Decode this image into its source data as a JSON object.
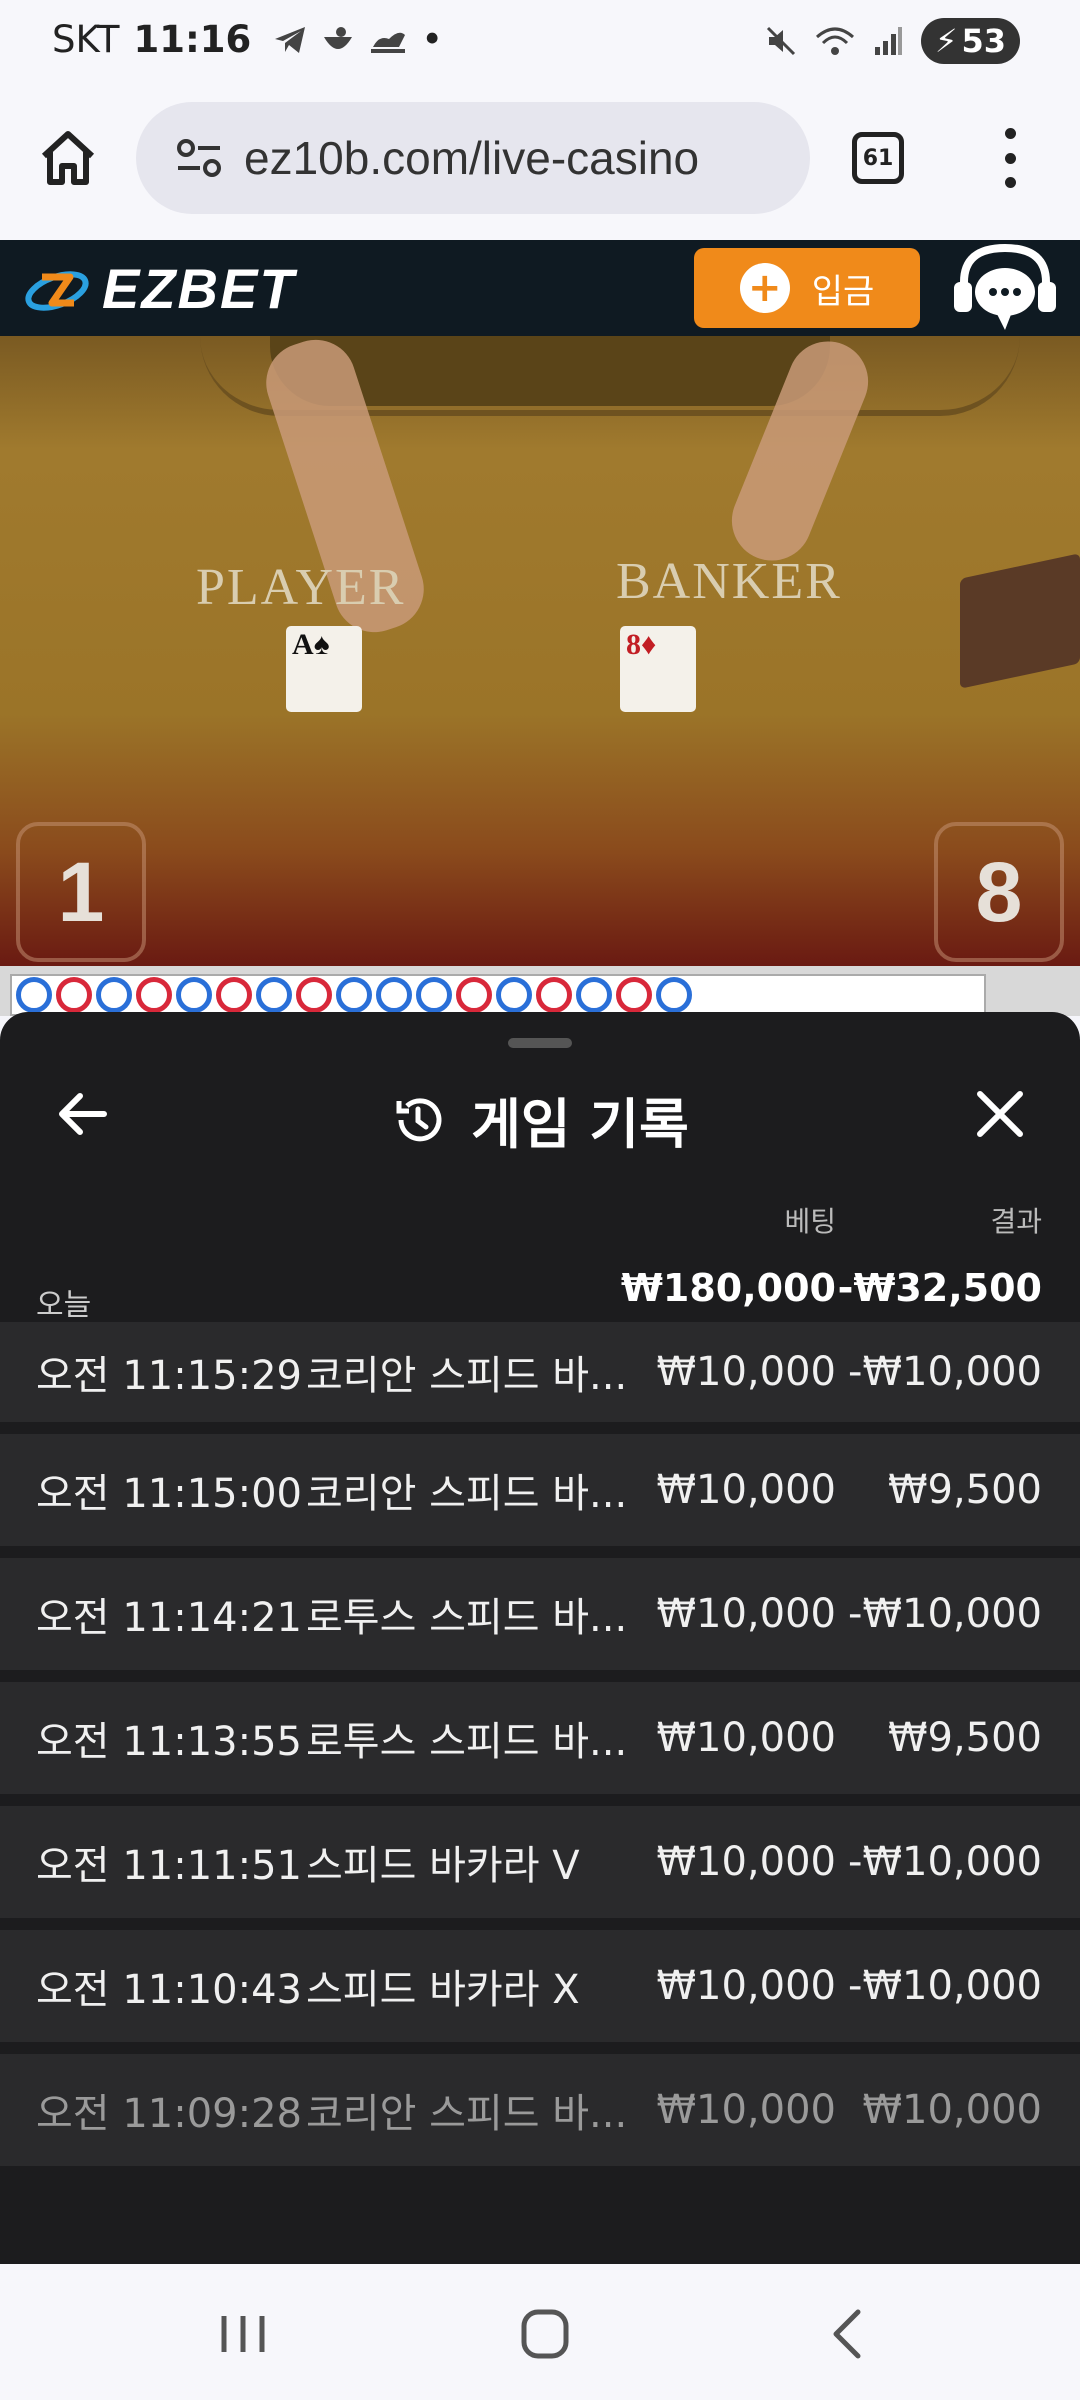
{
  "status_bar": {
    "carrier": "SKT",
    "time": "11:16",
    "dot": "•",
    "battery": "53",
    "icons": [
      "telegram-icon",
      "app-icon",
      "app-icon-2",
      "mute-icon",
      "wifi-icon",
      "signal-icon",
      "battery-icon"
    ]
  },
  "browser": {
    "url": "ez10b.com/live-casino",
    "tab_count": "61"
  },
  "site": {
    "logo_text": "EZBET",
    "deposit_label": "입금",
    "accent_color": "#f08a1a"
  },
  "video": {
    "player_label": "PLAYER",
    "banker_label": "BANKER",
    "player_card": {
      "rank": "A",
      "suit": "♠"
    },
    "banker_card": {
      "rank": "8",
      "suit": "♦"
    },
    "player_score": "1",
    "banker_score": "8"
  },
  "road": {
    "beads": [
      "blue",
      "red",
      "blue",
      "red",
      "blue",
      "red",
      "blue",
      "red",
      "blue",
      "blue",
      "blue",
      "red",
      "blue",
      "red",
      "blue",
      "red",
      "blue"
    ]
  },
  "history": {
    "title": "게임 기록",
    "col_bet": "베팅",
    "col_result": "결과",
    "today_label": "오늘",
    "today_bet": "₩180,000",
    "today_result": "-₩32,500",
    "rows": [
      {
        "time": "오전 11:15:29",
        "game": "코리안 스피드 바...",
        "bet": "₩10,000",
        "result": "-₩10,000"
      },
      {
        "time": "오전 11:15:00",
        "game": "코리안 스피드 바...",
        "bet": "₩10,000",
        "result": "₩9,500"
      },
      {
        "time": "오전 11:14:21",
        "game": "로투스 스피드 바...",
        "bet": "₩10,000",
        "result": "-₩10,000"
      },
      {
        "time": "오전 11:13:55",
        "game": "로투스 스피드 바...",
        "bet": "₩10,000",
        "result": "₩9,500"
      },
      {
        "time": "오전 11:11:51",
        "game": "스피드 바카라 V",
        "bet": "₩10,000",
        "result": "-₩10,000"
      },
      {
        "time": "오전 11:10:43",
        "game": "스피드 바카라 X",
        "bet": "₩10,000",
        "result": "-₩10,000"
      },
      {
        "time": "오전 11:09:28",
        "game": "코리안 스피드 바...",
        "bet": "₩10,000",
        "result": "₩10,000"
      }
    ]
  }
}
